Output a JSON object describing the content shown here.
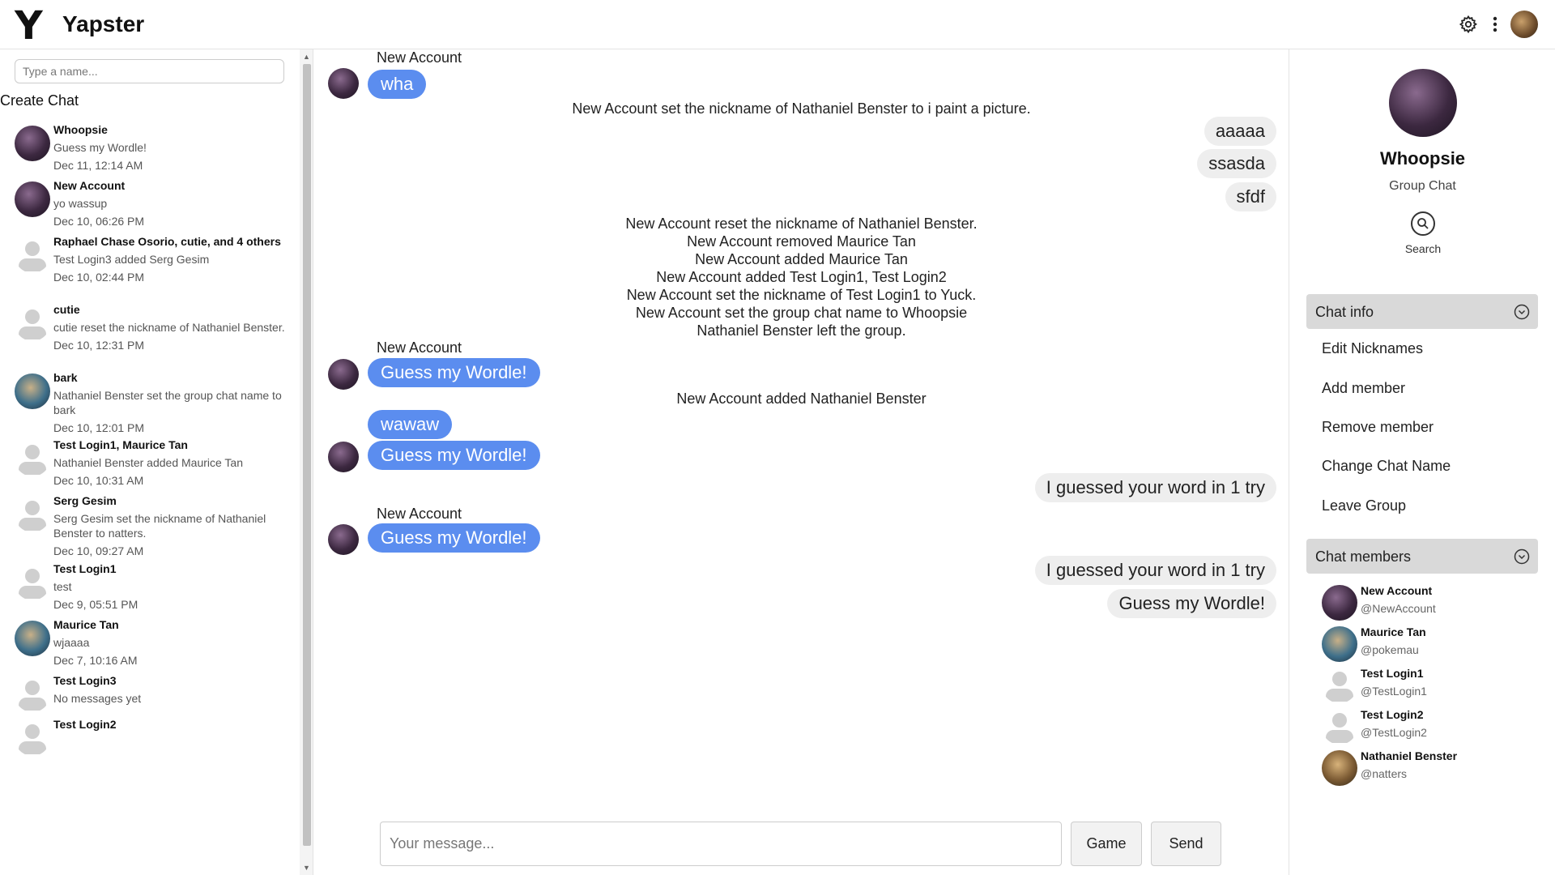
{
  "app": {
    "logo_letter": "Y",
    "title": "Yapster"
  },
  "header": {
    "settings_icon": "gear-icon",
    "more_icon": "more-vertical-icon"
  },
  "sidebar": {
    "search_placeholder": "Type a name...",
    "create_chat_label": "Create Chat",
    "chats": [
      {
        "name": "Whoopsie",
        "preview": "Guess my Wordle!",
        "time": "Dec 11, 12:14 AM",
        "avatar": "dark"
      },
      {
        "name": "New Account",
        "preview": "yo wassup",
        "time": "Dec 10, 06:26 PM",
        "avatar": "dark"
      },
      {
        "name": "Raphael Chase Osorio, cutie, and 4 others",
        "preview": "Test Login3 added Serg Gesim",
        "time": "Dec 10, 02:44 PM",
        "avatar": "default"
      },
      {
        "name": "cutie",
        "preview": "cutie reset the nickname of Nathaniel Benster.",
        "time": "Dec 10, 12:31 PM",
        "avatar": "default"
      },
      {
        "name": "bark",
        "preview": "Nathaniel Benster set the group chat name to bark",
        "time": "Dec 10, 12:01 PM",
        "avatar": "blue"
      },
      {
        "name": "Test Login1, Maurice Tan",
        "preview": "Nathaniel Benster added Maurice Tan",
        "time": "Dec 10, 10:31 AM",
        "avatar": "default"
      },
      {
        "name": "Serg Gesim",
        "preview": "Serg Gesim set the nickname of Nathaniel Benster to natters.",
        "time": "Dec 10, 09:27 AM",
        "avatar": "default"
      },
      {
        "name": "Test Login1",
        "preview": "test",
        "time": "Dec 9, 05:51 PM",
        "avatar": "default"
      },
      {
        "name": "Maurice Tan",
        "preview": "wjaaaa",
        "time": "Dec 7, 10:16 AM",
        "avatar": "blue"
      },
      {
        "name": "Test Login3",
        "preview": "No messages yet",
        "time": "",
        "avatar": "default"
      },
      {
        "name": "Test Login2",
        "preview": "",
        "time": "",
        "avatar": "default"
      }
    ]
  },
  "messages": {
    "items": [
      {
        "kind": "sender",
        "text": "New Account"
      },
      {
        "kind": "in",
        "text": "wha"
      },
      {
        "kind": "system",
        "text": "New Account set the nickname of Nathaniel Benster to i paint a picture."
      },
      {
        "kind": "out",
        "text": "aaaaa"
      },
      {
        "kind": "out",
        "text": "ssasda"
      },
      {
        "kind": "out",
        "text": "sfdf"
      },
      {
        "kind": "system",
        "text": "New Account reset the nickname of Nathaniel Benster."
      },
      {
        "kind": "system",
        "text": "New Account removed Maurice Tan"
      },
      {
        "kind": "system",
        "text": "New Account added Maurice Tan"
      },
      {
        "kind": "system",
        "text": "New Account added Test Login1, Test Login2"
      },
      {
        "kind": "system",
        "text": "New Account set the nickname of Test Login1 to Yuck."
      },
      {
        "kind": "system",
        "text": "New Account set the group chat name to Whoopsie"
      },
      {
        "kind": "system",
        "text": "Nathaniel Benster left the group."
      },
      {
        "kind": "sender",
        "text": "New Account"
      },
      {
        "kind": "in",
        "text": "Guess my Wordle!"
      },
      {
        "kind": "system",
        "text": "New Account added Nathaniel Benster"
      },
      {
        "kind": "in",
        "text": "wawaw"
      },
      {
        "kind": "in",
        "text": "Guess my Wordle!"
      },
      {
        "kind": "out",
        "text": "I guessed your word in 1 try"
      },
      {
        "kind": "sender",
        "text": "New Account"
      },
      {
        "kind": "in",
        "text": "Guess my Wordle!"
      },
      {
        "kind": "out",
        "text": "I guessed your word in 1 try"
      },
      {
        "kind": "out",
        "text": "Guess my Wordle!"
      }
    ]
  },
  "composer": {
    "placeholder": "Your message...",
    "game_label": "Game",
    "send_label": "Send"
  },
  "right_panel": {
    "group_name": "Whoopsie",
    "group_type": "Group Chat",
    "search_label": "Search",
    "chat_info_title": "Chat info",
    "chat_info_items": [
      "Edit Nicknames",
      "Add member",
      "Remove member",
      "Change Chat Name",
      "Leave Group"
    ],
    "chat_members_title": "Chat members",
    "members": [
      {
        "name": "New Account",
        "handle": "@NewAccount",
        "avatar": "dark"
      },
      {
        "name": "Maurice Tan",
        "handle": "@pokemau",
        "avatar": "blue"
      },
      {
        "name": "Test Login1",
        "handle": "@TestLogin1",
        "avatar": "default"
      },
      {
        "name": "Test Login2",
        "handle": "@TestLogin2",
        "avatar": "default"
      },
      {
        "name": "Nathaniel Benster",
        "handle": "@natters",
        "avatar": "brown"
      }
    ]
  },
  "colors": {
    "accent": "#5b8def",
    "outgoing_bubble": "#eeeeee",
    "section_header": "#d9d9d9"
  }
}
